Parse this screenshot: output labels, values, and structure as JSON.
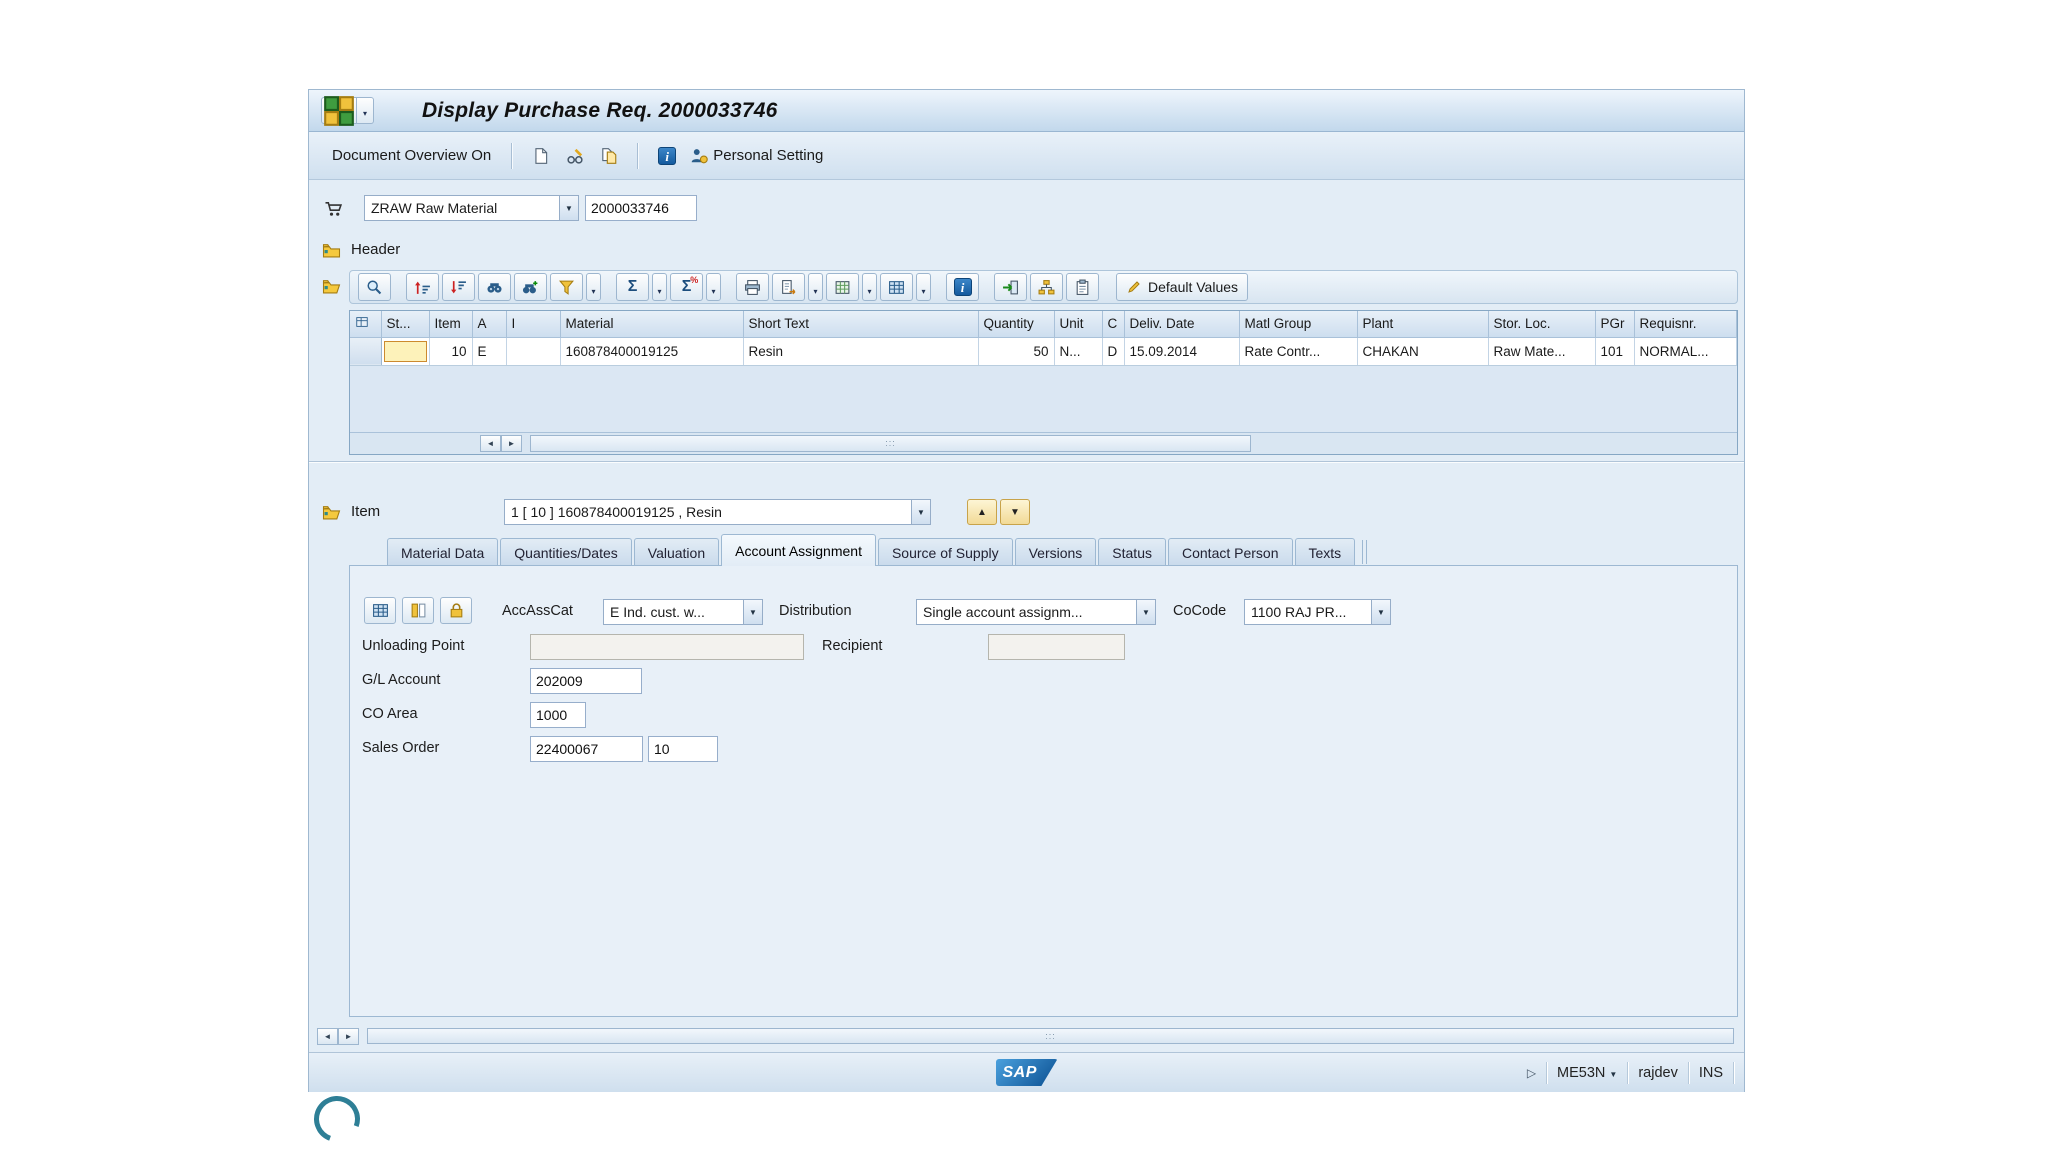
{
  "window": {
    "title": "Display Purchase Req. 2000033746"
  },
  "app_toolbar": {
    "document_overview": "Document Overview On",
    "personal_setting": "Personal Setting"
  },
  "doc_type": {
    "value": "ZRAW Raw Material",
    "number": "2000033746"
  },
  "sections": {
    "header": "Header",
    "item": "Item"
  },
  "grid_toolbar": {
    "default_values": "Default Values"
  },
  "items_table": {
    "columns": [
      "",
      "St...",
      "Item",
      "A",
      "I",
      "Material",
      "Short Text",
      "Quantity",
      "Unit",
      "C",
      "Deliv. Date",
      "Matl Group",
      "Plant",
      "Stor. Loc.",
      "PGr",
      "Requisnr."
    ],
    "rows": [
      {
        "item": "10",
        "a": "E",
        "i": "",
        "material": "160878400019125",
        "short_text": "Resin",
        "quantity": "50",
        "unit": "N...",
        "c": "D",
        "deliv_date": "15.09.2014",
        "matl_group": "Rate Contr...",
        "plant": "CHAKAN",
        "stor_loc": "Raw Mate...",
        "pgr": "101",
        "requisnr": "NORMAL..."
      }
    ]
  },
  "item_nav": {
    "selected": "1 [ 10 ] 160878400019125 , Resin"
  },
  "tabs": [
    {
      "label": "Material Data",
      "active": false
    },
    {
      "label": "Quantities/Dates",
      "active": false
    },
    {
      "label": "Valuation",
      "active": false
    },
    {
      "label": "Account Assignment",
      "active": true
    },
    {
      "label": "Source of Supply",
      "active": false
    },
    {
      "label": "Versions",
      "active": false
    },
    {
      "label": "Status",
      "active": false
    },
    {
      "label": "Contact Person",
      "active": false
    },
    {
      "label": "Texts",
      "active": false
    }
  ],
  "account_assignment": {
    "accasscat_label": "AccAssCat",
    "accasscat_value": "E Ind. cust. w...",
    "distribution_label": "Distribution",
    "distribution_value": "Single account assignm...",
    "cocode_label": "CoCode",
    "cocode_value": "1100 RAJ PR...",
    "unloading_point_label": "Unloading Point",
    "unloading_point_value": "",
    "recipient_label": "Recipient",
    "recipient_value": "",
    "gl_account_label": "G/L Account",
    "gl_account_value": "202009",
    "co_area_label": "CO Area",
    "co_area_value": "1000",
    "sales_order_label": "Sales Order",
    "sales_order_value": "22400067",
    "sales_order_item": "10"
  },
  "status_bar": {
    "transaction": "ME53N",
    "user": "rajdev",
    "mode": "INS",
    "logo": "SAP"
  },
  "icons": {
    "caret_down": "▼",
    "caret_small": "▾",
    "up": "▲",
    "down": "▼",
    "left": "◄",
    "right": "►",
    "status_expand": "▷",
    "grip": ":::",
    "sum": "Σ",
    "percent": "%",
    "info": "i"
  }
}
